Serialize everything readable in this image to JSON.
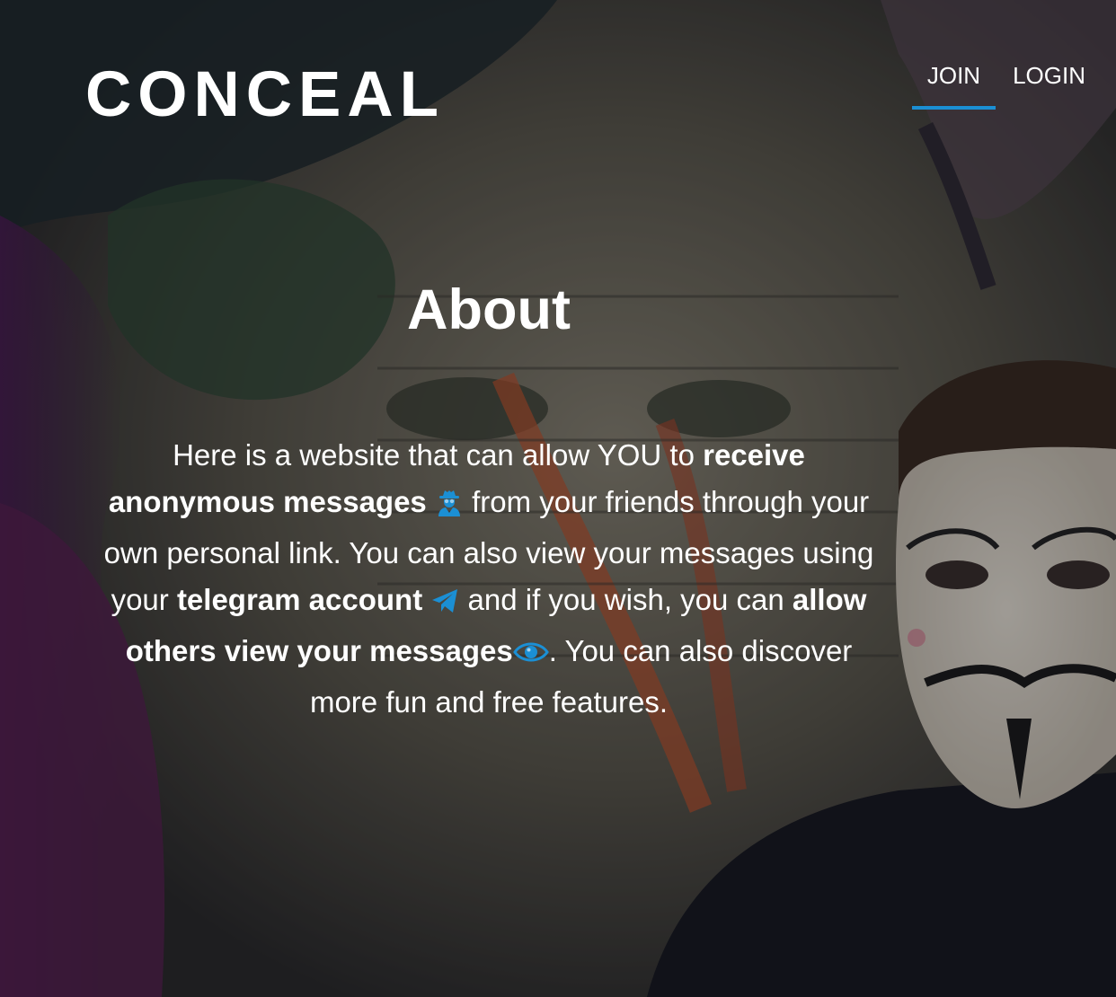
{
  "header": {
    "logo": "CONCEAL",
    "nav": [
      {
        "label": "JOIN",
        "active": true
      },
      {
        "label": "LOGIN",
        "active": false
      }
    ]
  },
  "about": {
    "title": "About",
    "segments": {
      "t1": "Here is a website that can allow YOU to ",
      "b1": "receive anonymous messages",
      "t2": " from your friends through your own personal link. You can also view your messages using your ",
      "b2": "telegram account",
      "t3": " and if you wish, you can ",
      "b3": "allow others view your messages",
      "t4": ". You can also discover more fun and free features."
    },
    "icons": [
      "spy-icon",
      "telegram-icon",
      "eye-icon"
    ]
  },
  "colors": {
    "accent": "#1b8fd4",
    "text": "#ffffff"
  }
}
